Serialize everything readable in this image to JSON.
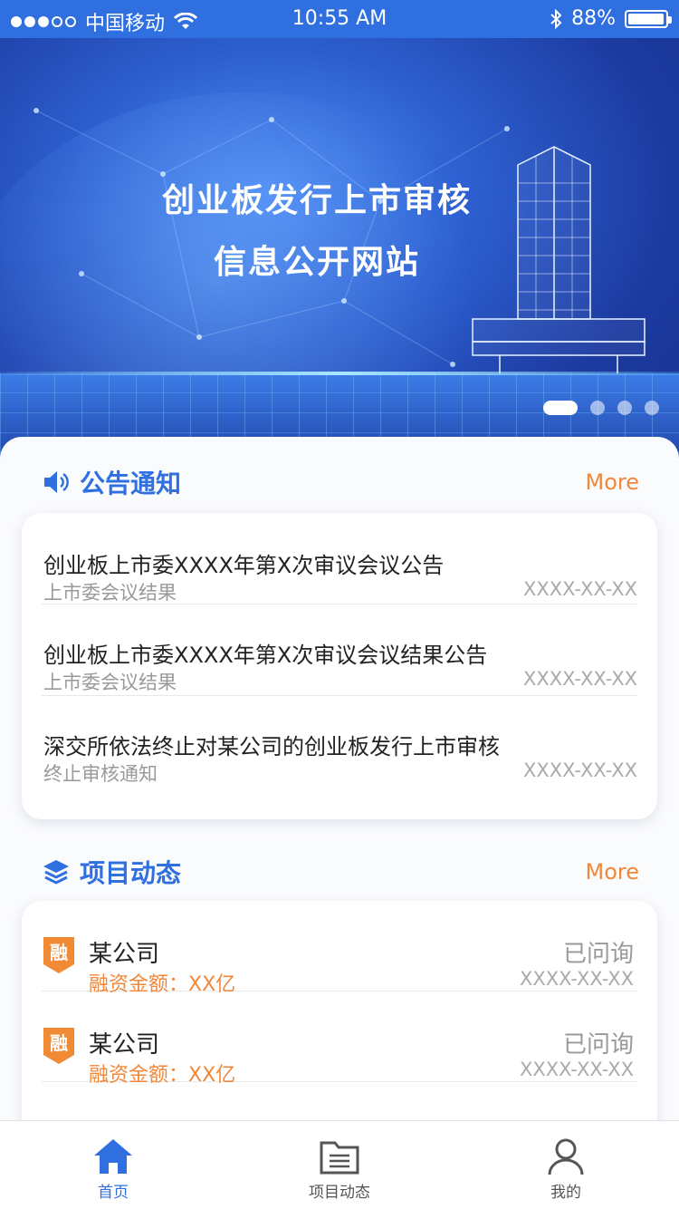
{
  "status_bar": {
    "carrier": "中国移动",
    "time": "10:55 AM",
    "battery": "88%"
  },
  "banner": {
    "line1": "创业板发行上市审核",
    "line2": "信息公开网站"
  },
  "announcements": {
    "title": "公告通知",
    "more": "More",
    "items": [
      {
        "title": "创业板上市委XXXX年第X次审议会议公告",
        "category": "上市委会议结果",
        "date": "XXXX-XX-XX"
      },
      {
        "title": "创业板上市委XXXX年第X次审议会议结果公告",
        "category": "上市委会议结果",
        "date": "XXXX-XX-XX"
      },
      {
        "title": "深交所依法终止对某公司的创业板发行上市审核",
        "category": "终止审核通知",
        "date": "XXXX-XX-XX"
      }
    ]
  },
  "projects": {
    "title": "项目动态",
    "more": "More",
    "badge": "融",
    "items": [
      {
        "company": "某公司",
        "amount_label": "融资金额：",
        "amount": "XX亿",
        "status": "已问询",
        "date": "XXXX-XX-XX"
      },
      {
        "company": "某公司",
        "amount_label": "融资金额：",
        "amount": "XX亿",
        "status": "已问询",
        "date": "XXXX-XX-XX"
      }
    ]
  },
  "tabbar": {
    "tabs": [
      {
        "label": "首页",
        "icon": "home-icon",
        "active": true
      },
      {
        "label": "项目动态",
        "icon": "folder-list-icon",
        "active": false
      },
      {
        "label": "我的",
        "icon": "user-icon",
        "active": false
      }
    ]
  },
  "colors": {
    "primary": "#2f6fe0",
    "accent": "#f0873a"
  }
}
